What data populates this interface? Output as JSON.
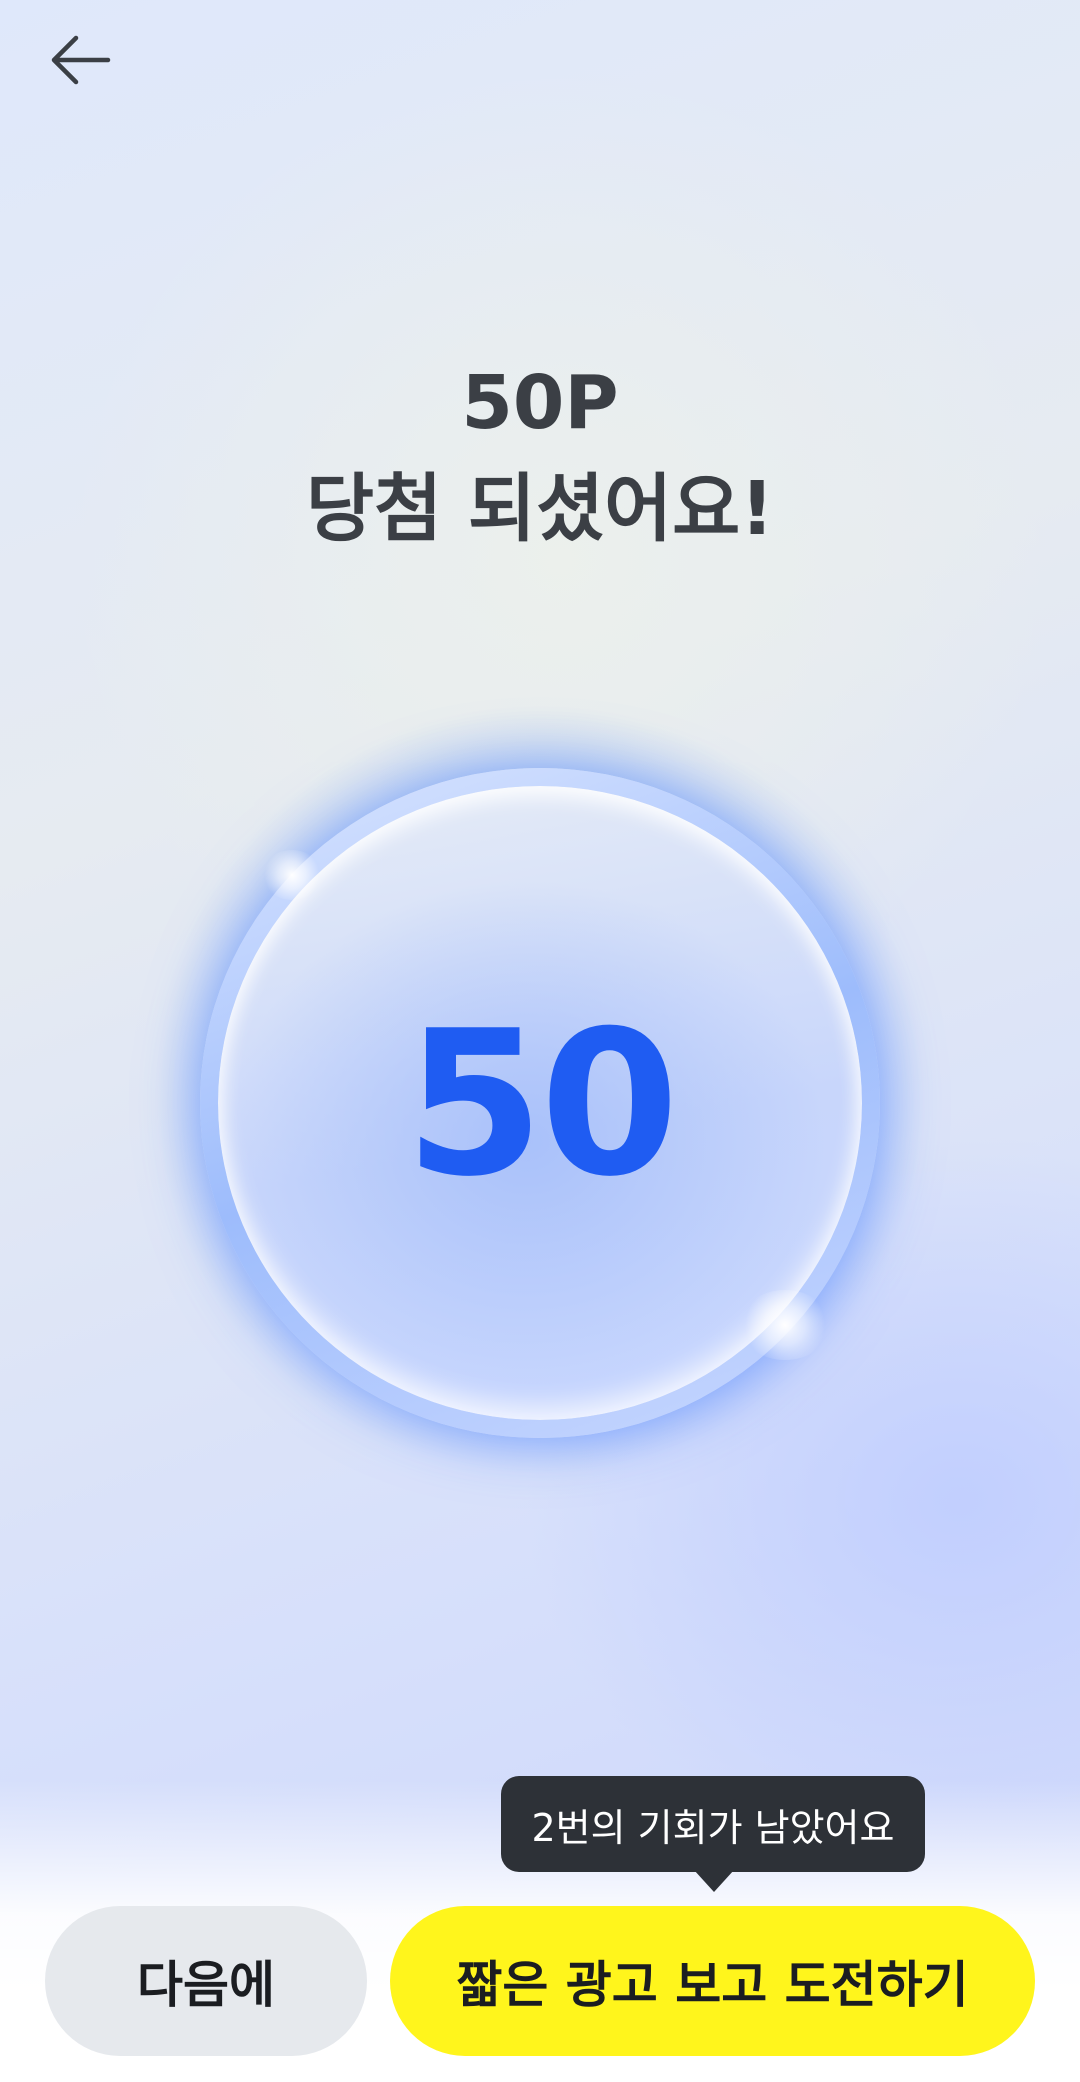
{
  "nav": {
    "back_icon": "arrow-left-icon"
  },
  "result": {
    "points_label": "50P",
    "message": "당첨 되셨어요!"
  },
  "ball": {
    "value": "50"
  },
  "tooltip": {
    "text": "2번의 기회가 남았어요"
  },
  "buttons": {
    "next_label": "다음에",
    "ad_label": "짧은 광고 보고 도전하기"
  },
  "colors": {
    "accent_blue": "#1f5cf2",
    "cta_yellow": "#fff51c",
    "secondary_gray": "#e6e9ed",
    "tooltip_dark": "#2d3137",
    "title_text": "#3b3f45"
  }
}
